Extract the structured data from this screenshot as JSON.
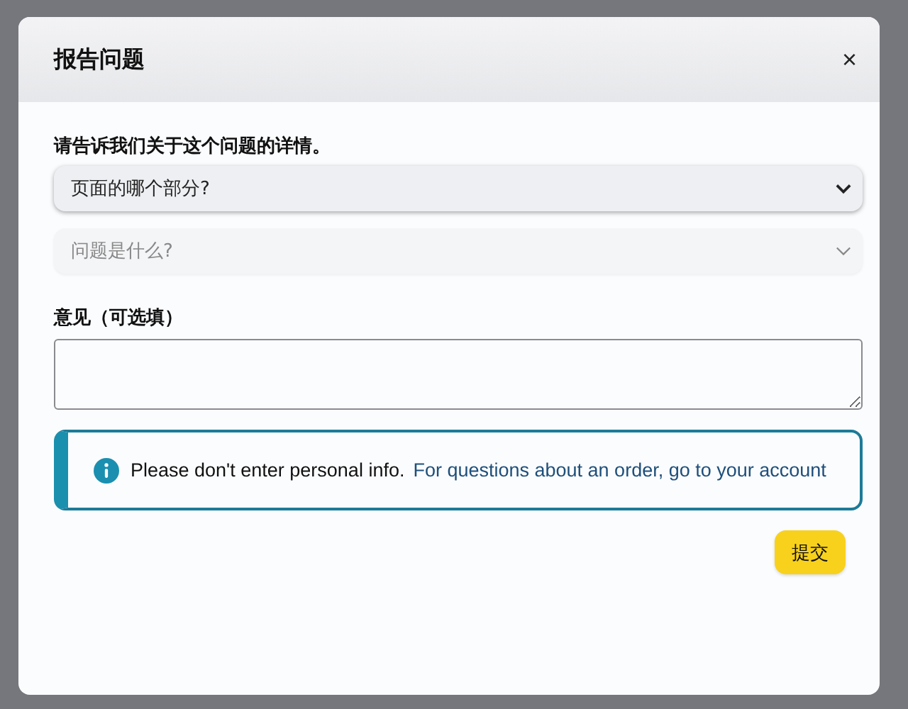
{
  "dialog": {
    "title": "报告问题",
    "close": "×",
    "prompt": "请告诉我们关于这个问题的详情。",
    "dropdowns": [
      {
        "placeholder": "页面的哪个部分?",
        "disabled": false
      },
      {
        "placeholder": "问题是什么?",
        "disabled": true
      }
    ],
    "comment": {
      "label": "意见（可选填）"
    },
    "notice": {
      "text": "Please don't enter personal info.",
      "link": "For questions about an order, go to your account"
    },
    "buttons": [
      {
        "label": "提交"
      }
    ]
  }
}
